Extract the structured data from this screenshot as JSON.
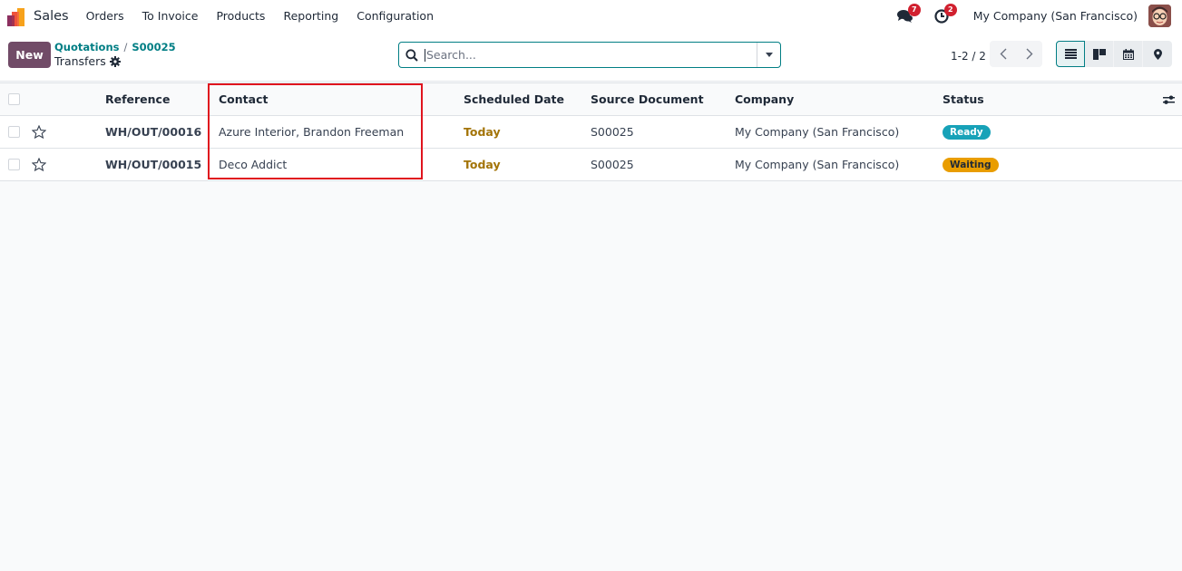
{
  "navbar": {
    "app_name": "Sales",
    "menu": [
      "Orders",
      "To Invoice",
      "Products",
      "Reporting",
      "Configuration"
    ],
    "messages_icon": "chat-icon",
    "messages_count": "7",
    "activities_icon": "clock-icon",
    "activities_count": "2",
    "company": "My Company (San Francisco)",
    "avatar_icon": "user-avatar"
  },
  "control": {
    "new_label": "New",
    "breadcrumb": [
      "Quotations",
      "S00025"
    ],
    "breadcrumb_separator": "/",
    "title": "Transfers",
    "search_placeholder": "Search...",
    "search_value": "",
    "pager": "1-2 / 2",
    "views": [
      "list",
      "kanban",
      "calendar",
      "map"
    ],
    "active_view": "list"
  },
  "table": {
    "columns": [
      "Reference",
      "Contact",
      "Scheduled Date",
      "Source Document",
      "Company",
      "Status"
    ],
    "rows": [
      {
        "reference": "WH/OUT/00016",
        "contact": "Azure Interior, Brandon Freeman",
        "scheduled_date": "Today",
        "source": "S00025",
        "company": "My Company (San Francisco)",
        "status": "Ready"
      },
      {
        "reference": "WH/OUT/00015",
        "contact": "Deco Addict",
        "scheduled_date": "Today",
        "source": "S00025",
        "company": "My Company (San Francisco)",
        "status": "Waiting"
      }
    ]
  },
  "colors": {
    "brand": "#714b67",
    "accent": "#017e84",
    "ready": "#17a2b8",
    "waiting": "#e99d00",
    "today": "#a37408",
    "highlight": "#e0141e"
  }
}
